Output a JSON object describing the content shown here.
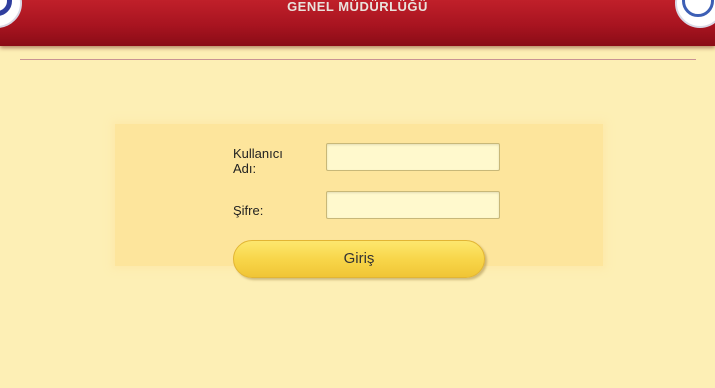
{
  "header": {
    "title": "GENEL MÜDÜRLÜĞÜ",
    "logo_left_icon": "ministry-seal-icon",
    "logo_right_icon": "ministry-emblem-icon",
    "colors": {
      "header_red": "#a81420",
      "page_bg": "#fdefb5"
    }
  },
  "login": {
    "username_label": "Kullanıcı Adı:",
    "username_value": "",
    "password_label": "Şifre:",
    "password_value": "",
    "submit_label": "Giriş"
  }
}
